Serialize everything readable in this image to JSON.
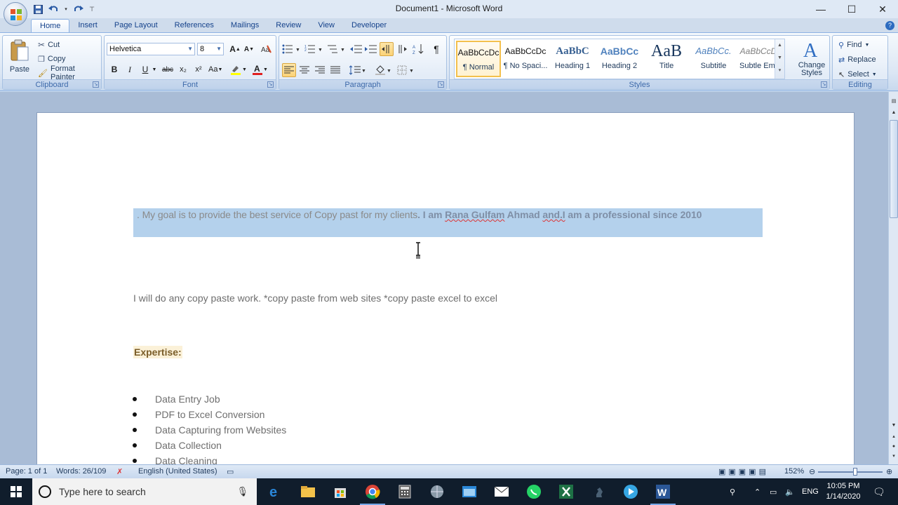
{
  "window": {
    "title": "Document1 - Microsoft Word",
    "controls": {
      "minimize": "—",
      "maximize": "☐",
      "close": "✕"
    }
  },
  "quick_access": [
    "save-icon",
    "undo-icon",
    "redo-icon",
    "customize-icon"
  ],
  "tabs": [
    {
      "label": "Home",
      "active": true
    },
    {
      "label": "Insert"
    },
    {
      "label": "Page Layout"
    },
    {
      "label": "References"
    },
    {
      "label": "Mailings"
    },
    {
      "label": "Review"
    },
    {
      "label": "View"
    },
    {
      "label": "Developer"
    }
  ],
  "ribbon": {
    "clipboard": {
      "paste": "Paste",
      "cut": "Cut",
      "copy": "Copy",
      "format_painter": "Format Painter",
      "label": "Clipboard"
    },
    "font": {
      "name": "Helvetica",
      "size": "8",
      "label": "Font",
      "bold": "B",
      "italic": "I",
      "underline": "U",
      "strike": "abc",
      "subscript": "x₂",
      "superscript": "x²",
      "change_case": "Aa",
      "grow": "A",
      "shrink": "A"
    },
    "paragraph": {
      "label": "Paragraph"
    },
    "styles": {
      "label": "Styles",
      "items": [
        {
          "sample": "AaBbCcDc",
          "name": "¶ Normal",
          "selected": true
        },
        {
          "sample": "AaBbCcDc",
          "name": "¶ No Spaci..."
        },
        {
          "sample": "AaBbC",
          "name": "Heading 1"
        },
        {
          "sample": "AaBbCc",
          "name": "Heading 2"
        },
        {
          "sample": "AaB",
          "name": "Title"
        },
        {
          "sample": "AaBbCc.",
          "name": "Subtitle"
        },
        {
          "sample": "AaBbCcDc",
          "name": "Subtle Em..."
        }
      ],
      "change_styles": "Change Styles"
    },
    "editing": {
      "find": "Find",
      "replace": "Replace",
      "select": "Select",
      "label": "Editing"
    }
  },
  "document": {
    "line1_normal": ". My goal is to provide the best service of Copy past for my clients",
    "line1_bold_prefix": ". I am ",
    "line1_name": "Rana Gulfam",
    "line1_mid": " Ahmad ",
    "line1_and": "and.I",
    "line1_bold_suffix": " am a professional since 2010",
    "line2": "I will do any copy paste work. *copy paste from web sites *copy paste excel to excel",
    "heading": "Expertise:",
    "bullets": [
      "Data Entry Job",
      "PDF to Excel Conversion",
      "Data Capturing from Websites",
      "Data Collection",
      "Data Cleaning"
    ]
  },
  "status": {
    "page": "Page: 1 of 1",
    "words": "Words: 26/109",
    "language": "English (United States)",
    "zoom": "152%"
  },
  "taskbar": {
    "search_placeholder": "Type here to search",
    "lang": "ENG",
    "time": "10:05 PM",
    "date": "1/14/2020"
  }
}
